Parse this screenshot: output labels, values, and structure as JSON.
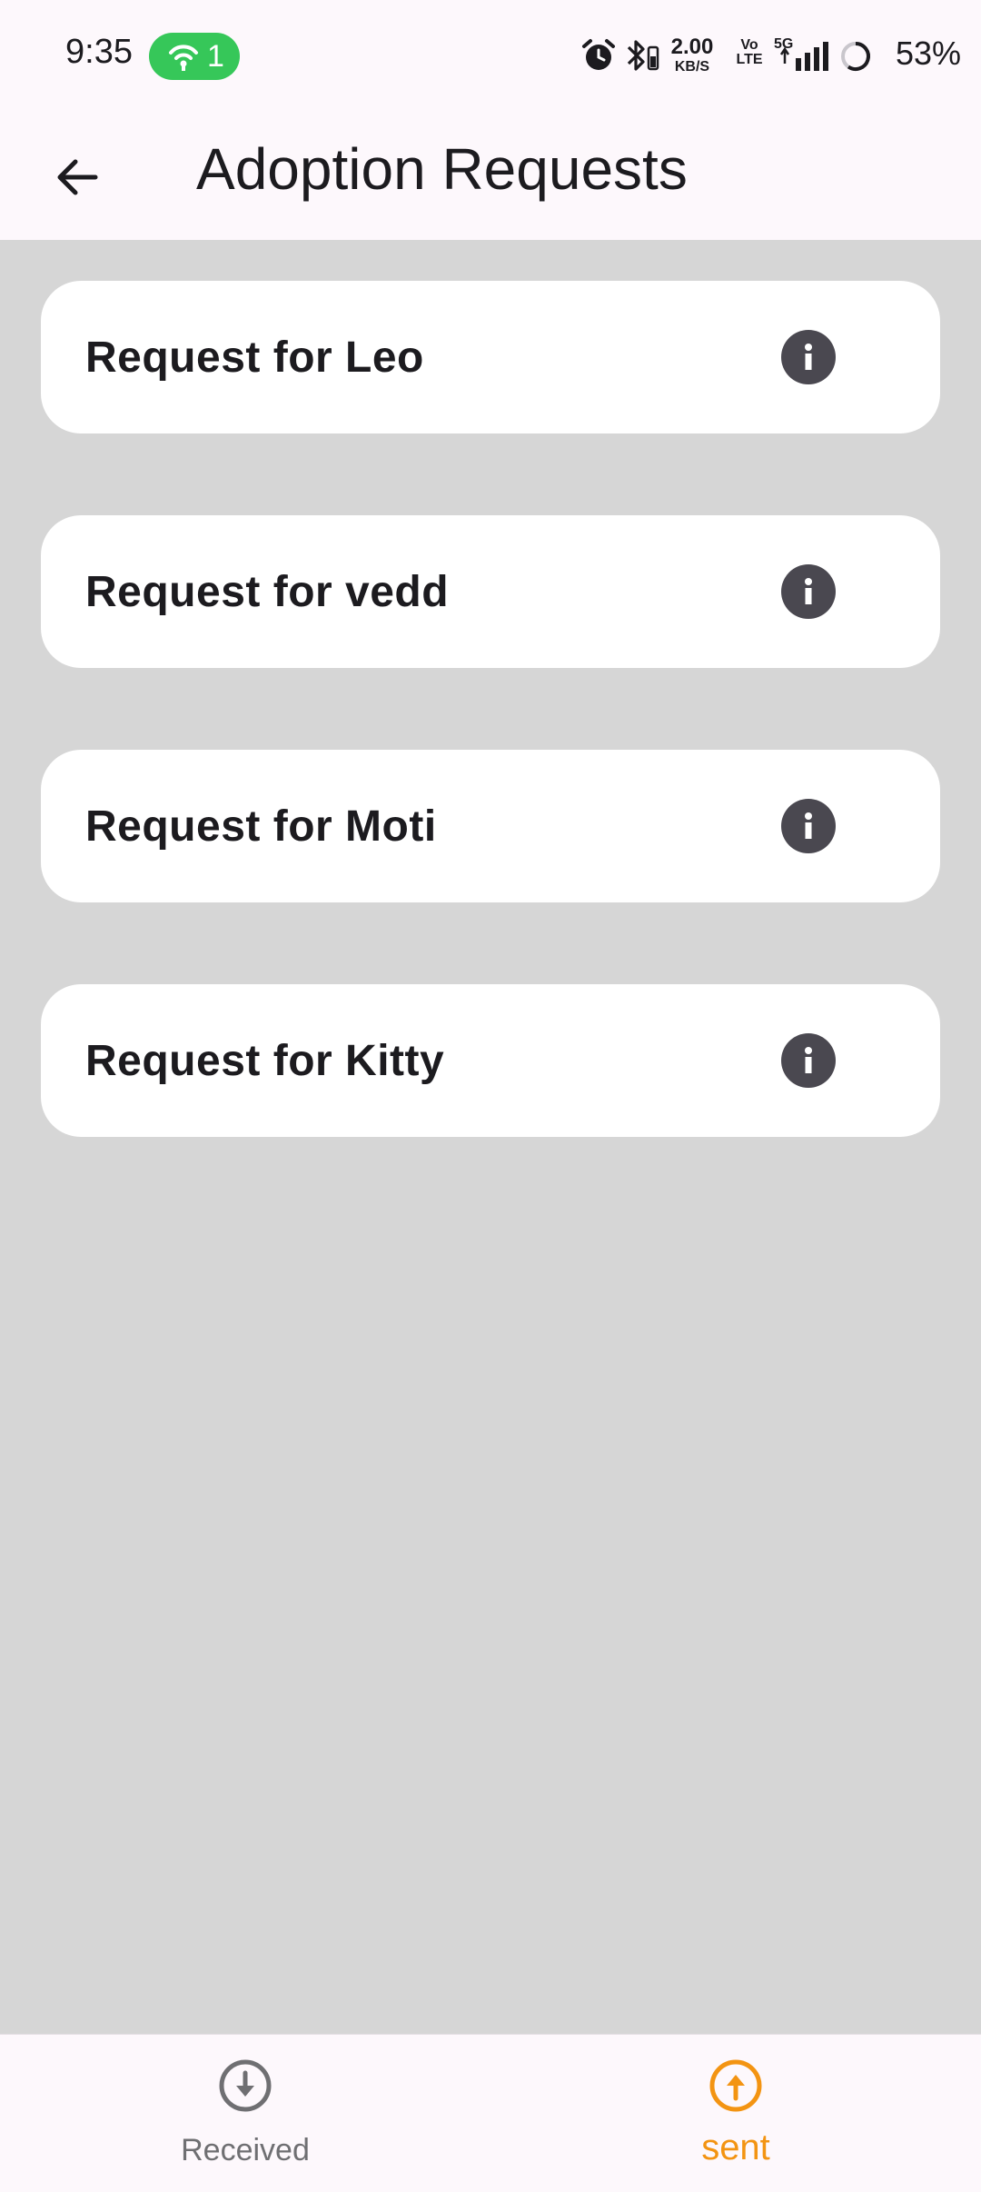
{
  "status_bar": {
    "time": "9:35",
    "hotspot_count": "1",
    "net_speed_value": "2.00",
    "net_speed_unit": "KB/S",
    "volte_top": "Vo",
    "volte_bottom": "LTE",
    "network_type": "5G",
    "battery_percent": "53%",
    "icons": [
      "hotspot-icon",
      "alarm-icon",
      "bluetooth-icon",
      "signal-icon",
      "battery-icon"
    ]
  },
  "app_bar": {
    "back_icon": "arrow-back-icon",
    "title": "Adoption Requests"
  },
  "requests": [
    {
      "label": "Request for Leo",
      "icon": "info-icon"
    },
    {
      "label": "Request for vedd",
      "icon": "info-icon"
    },
    {
      "label": "Request for Moti",
      "icon": "info-icon"
    },
    {
      "label": "Request for Kitty",
      "icon": "info-icon"
    }
  ],
  "bottom_nav": {
    "items": [
      {
        "label": "Received",
        "icon": "arrow-down-circle-icon",
        "active": false
      },
      {
        "label": "sent",
        "icon": "arrow-up-circle-icon",
        "active": true
      }
    ]
  },
  "colors": {
    "background": "#d6d6d6",
    "bar_background": "#fdf8fc",
    "card": "#ffffff",
    "accent": "#f39412",
    "inactive": "#6f6f72",
    "hotspot": "#36c759",
    "info_icon": "#4a4850"
  }
}
